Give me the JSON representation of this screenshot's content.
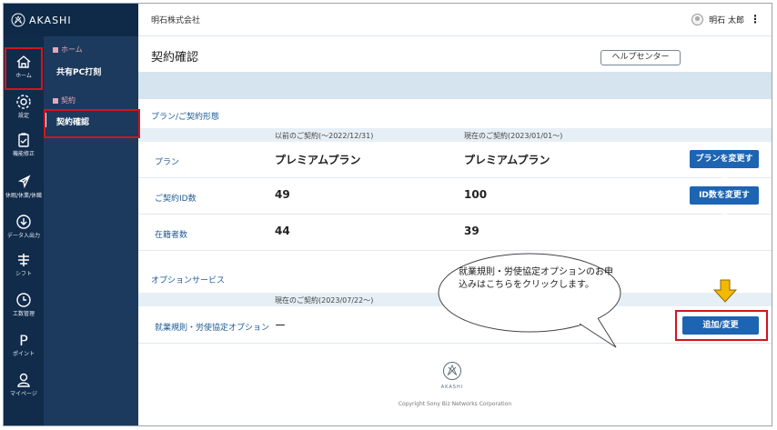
{
  "brand": {
    "name": "AKASHI"
  },
  "rail": [
    {
      "label": "ホーム",
      "icon": "home-icon"
    },
    {
      "label": "設定",
      "icon": "gear-icon"
    },
    {
      "label": "機能修正",
      "icon": "clipboard-icon"
    },
    {
      "label": "休暇/休業/休職",
      "icon": "leaf-icon"
    },
    {
      "label": "データ入出力",
      "icon": "download-icon"
    },
    {
      "label": "シフト",
      "icon": "shift-icon"
    },
    {
      "label": "工数管理",
      "icon": "clock-icon"
    },
    {
      "label": "ポイント",
      "icon": "point-icon"
    },
    {
      "label": "マイページ",
      "icon": "person-icon"
    }
  ],
  "subnav": {
    "home_section": "ホーム",
    "home_link": "共有PC打刻",
    "contract_section": "契約",
    "contract_link": "契約確認"
  },
  "topbar": {
    "company": "明石株式会社",
    "user": "明石 太郎"
  },
  "page": {
    "title": "契約確認",
    "help_button": "ヘルプセンター"
  },
  "plan": {
    "section_title": "プラン/ご契約形態",
    "col_prev": "以前のご契約(～2022/12/31)",
    "col_curr": "現在のご契約(2023/01/01～)",
    "rows": [
      {
        "label": "プラン",
        "prev": "プレミアムプラン",
        "curr": "プレミアムプラン",
        "action": "プランを変更する"
      },
      {
        "label": "ご契約ID数",
        "prev": "49",
        "curr": "100",
        "action": "ID数を変更する"
      },
      {
        "label": "在籍者数",
        "prev": "44",
        "curr": "39"
      }
    ]
  },
  "options": {
    "section_title": "オプションサービス",
    "col_curr": "現在のご契約(2023/07/22～)",
    "rows": [
      {
        "label": "就業規則・労使協定オプション",
        "value": "ー",
        "action": "追加/変更"
      }
    ]
  },
  "callout": {
    "text": "就業規則・労使協定オプションのお申込みはこちらをクリックします。"
  },
  "footer": {
    "logo_text": "AKASHI",
    "copyright": "Copyright Sony Biz Networks Corporation"
  },
  "colors": {
    "rail": "#112b4a",
    "subnav": "#1b3a5e",
    "accent": "#1d64b3",
    "highlight": "#d2151d",
    "arrow": "#f5b800"
  }
}
